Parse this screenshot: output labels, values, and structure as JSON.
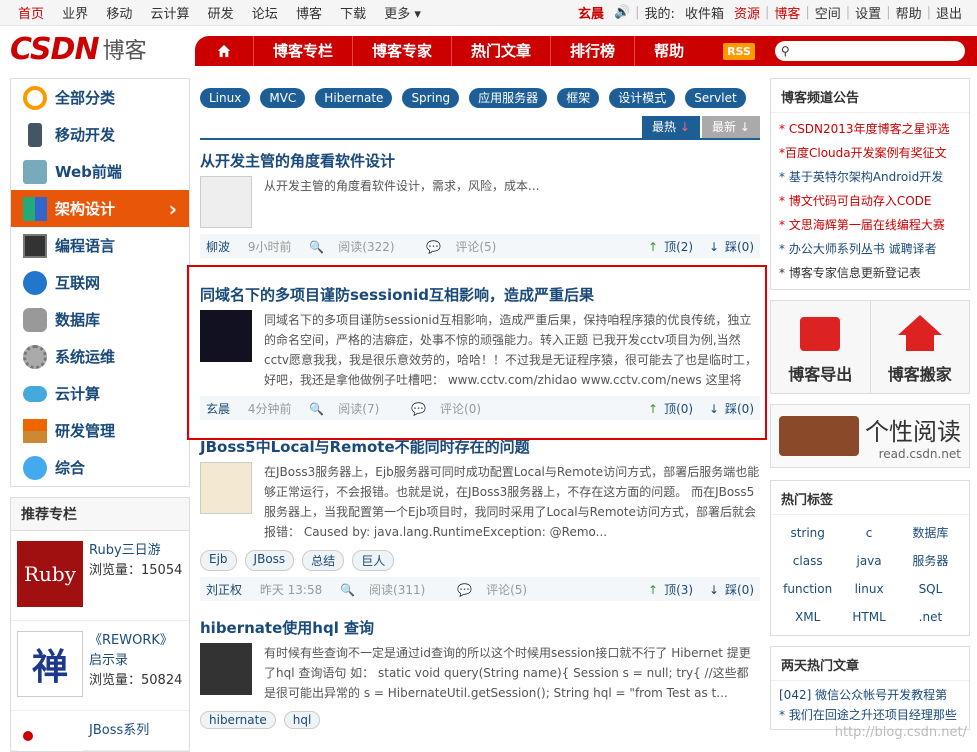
{
  "topbar": {
    "left": [
      "首页",
      "业界",
      "移动",
      "云计算",
      "研发",
      "论坛",
      "博客",
      "下载",
      "更多"
    ],
    "user": "玄晨",
    "right": [
      "我的:",
      "收件箱",
      "资源",
      "博客",
      "空间",
      "设置",
      "帮助",
      "退出"
    ]
  },
  "header": {
    "logo": "CSDN",
    "logo_suffix": "博客",
    "nav": [
      "博客专栏",
      "博客专家",
      "热门文章",
      "排行榜",
      "帮助"
    ],
    "rss": "RSS"
  },
  "categories": [
    "全部分类",
    "移动开发",
    "Web前端",
    "架构设计",
    "编程语言",
    "互联网",
    "数据库",
    "系统运维",
    "云计算",
    "研发管理",
    "综合"
  ],
  "active_category": "架构设计",
  "recommend": {
    "title": "推荐专栏",
    "items": [
      {
        "title": "Ruby三日游",
        "views_label": "浏览量：15054"
      },
      {
        "title": "《REWORK》启示录",
        "views_label": "浏览量：50824"
      },
      {
        "title": "JBoss系列",
        "views_label": ""
      }
    ]
  },
  "tags": [
    "Linux",
    "MVC",
    "Hibernate",
    "Spring",
    "应用服务器",
    "框架",
    "设计模式",
    "Servlet"
  ],
  "sort": {
    "hot": "最热",
    "new": "最新"
  },
  "articles": [
    {
      "title": "从开发主管的角度看软件设计",
      "summary": "从开发主管的角度看软件设计，需求，风险，成本...",
      "author": "柳波",
      "time": "9小时前",
      "read": "阅读(322)",
      "comment": "评论(5)",
      "up": "顶(2)",
      "down": "踩(0)"
    },
    {
      "title": "同域名下的多项目谨防sessionid互相影响，造成严重后果",
      "summary": "同域名下的多项目谨防sessionid互相影响，造成严重后果，保持咱程序猿的优良传统，独立的命名空间，严格的洁癖症，处事不惊的顽强能力。转入正题 已我开发cctv项目为例,当然cctv愿意我我，我是很乐意效劳的，哈哈！！不过我是无证程序猿，很可能去了也是临时工，好吧，我还是拿他做例子吐槽吧： www.cctv.com/zhidao www.cctv.com/news 这里将zhidao、...",
      "author": "玄晨",
      "time": "4分钟前",
      "read": "阅读(7)",
      "comment": "评论(0)",
      "up": "顶(0)",
      "down": "踩(0)"
    },
    {
      "title": "JBoss5中Local与Remote不能同时存在的问题",
      "summary": "在JBoss3服务器上，Ejb服务器可同时成功配置Local与Remote访问方式，部署后服务端也能够正常运行，不会报错。也就是说，在JBoss3服务器上，不存在这方面的问题。 而在JBoss5服务器上，当我配置第一个Ejb项目时，我同时采用了Local与Remote访问方式，部署后就会报错： Caused by: java.lang.RuntimeException: @Remo...",
      "author": "刘正权",
      "time": "昨天 13:58",
      "read": "阅读(311)",
      "comment": "评论(5)",
      "up": "顶(3)",
      "down": "踩(0)",
      "tags": [
        "Ejb",
        "JBoss",
        "总结",
        "巨人"
      ]
    },
    {
      "title": "hibernate使用hql 查询",
      "summary": "有时候有些查询不一定是通过id查询的所以这个时候用session接口就不行了 Hibernet 提更了hql 查询语句 如： static void query(String name){ Session s = null; try{ //这些都是很可能出异常的 s = HibernateUtil.getSession(); String hql = \"from Test as t...",
      "tags": [
        "hibernate",
        "hql"
      ]
    }
  ],
  "right": {
    "notice_title": "博客频道公告",
    "notices": [
      {
        "text": "* CSDN2013年度博客之星评选",
        "color": "red"
      },
      {
        "text": "*百度Clouda开发案例有奖征文",
        "color": "red"
      },
      {
        "text": "* 基于英特尔架构Android开发",
        "color": "blue"
      },
      {
        "text": "* 博文代码可自动存入CODE",
        "color": "red"
      },
      {
        "text": "* 文思海辉第一届在线编程大赛",
        "color": "red"
      },
      {
        "text": "* 办公大师系列丛书 诚聘译者",
        "color": "blue"
      },
      {
        "text": "* 博客专家信息更新登记表",
        "color": "black"
      }
    ],
    "promo": [
      "博客导出",
      "博客搬家"
    ],
    "read_title": "个性阅读",
    "read_url": "read.csdn.net",
    "hottags_title": "热门标签",
    "hottags": [
      "string",
      "c",
      "数据库",
      "class",
      "java",
      "服务器",
      "function",
      "linux",
      "SQL",
      "XML",
      "HTML",
      ".net"
    ],
    "hotarticles_title": "两天热门文章",
    "hotarticles": [
      "[042] 微信公众帐号开发教程第",
      "* 我们在回途之升还项目经理那些"
    ]
  },
  "watermark": "http://blog.csdn.net/"
}
